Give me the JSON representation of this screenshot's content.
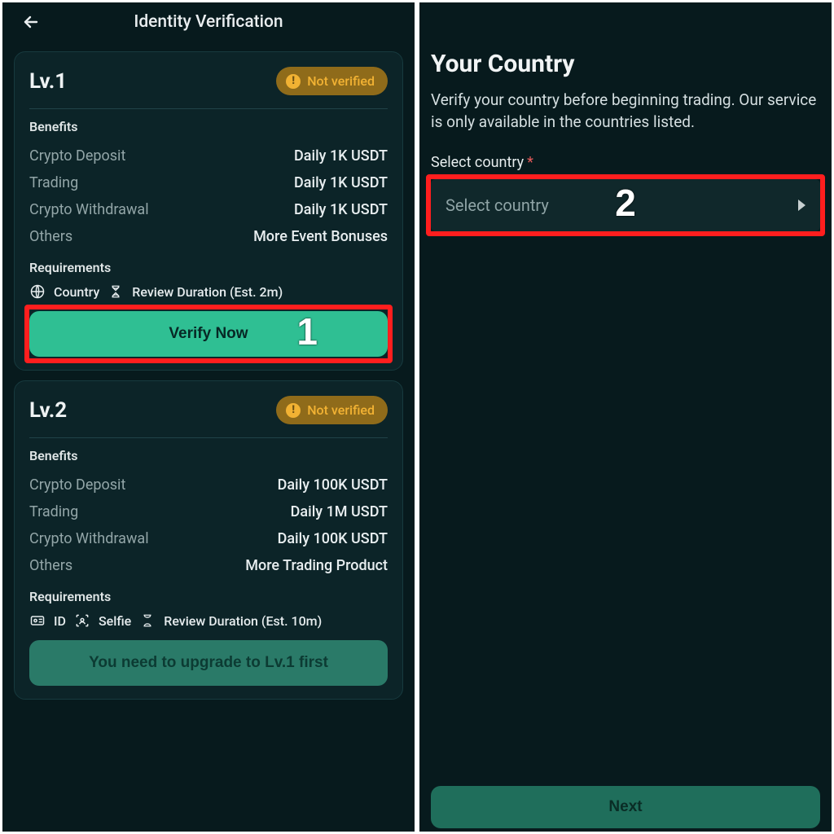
{
  "left": {
    "header_title": "Identity Verification",
    "lv1": {
      "title": "Lv.1",
      "badge": "Not verified",
      "benefits_label": "Benefits",
      "rows": [
        {
          "label": "Crypto Deposit",
          "value": "Daily 1K USDT"
        },
        {
          "label": "Trading",
          "value": "Daily 1K USDT"
        },
        {
          "label": "Crypto Withdrawal",
          "value": "Daily 1K USDT"
        },
        {
          "label": "Others",
          "value": "More Event Bonuses"
        }
      ],
      "requirements_label": "Requirements",
      "req_country": "Country",
      "req_review": "Review Duration (Est. 2m)",
      "verify_label": "Verify Now",
      "step_number": "1"
    },
    "lv2": {
      "title": "Lv.2",
      "badge": "Not verified",
      "benefits_label": "Benefits",
      "rows": [
        {
          "label": "Crypto Deposit",
          "value": "Daily 100K USDT"
        },
        {
          "label": "Trading",
          "value": "Daily 1M USDT"
        },
        {
          "label": "Crypto Withdrawal",
          "value": "Daily 100K USDT"
        },
        {
          "label": "Others",
          "value": "More Trading Product"
        }
      ],
      "requirements_label": "Requirements",
      "req_id": "ID",
      "req_selfie": "Selfie",
      "req_review": "Review Duration (Est. 10m)",
      "disabled_label": "You need to upgrade to Lv.1 first"
    }
  },
  "right": {
    "title": "Your Country",
    "subtitle": "Verify your country before beginning trading. Our service is only available in the countries listed.",
    "select_label": "Select country",
    "asterisk": "*",
    "select_placeholder": "Select country",
    "step_number": "2",
    "next_label": "Next"
  }
}
